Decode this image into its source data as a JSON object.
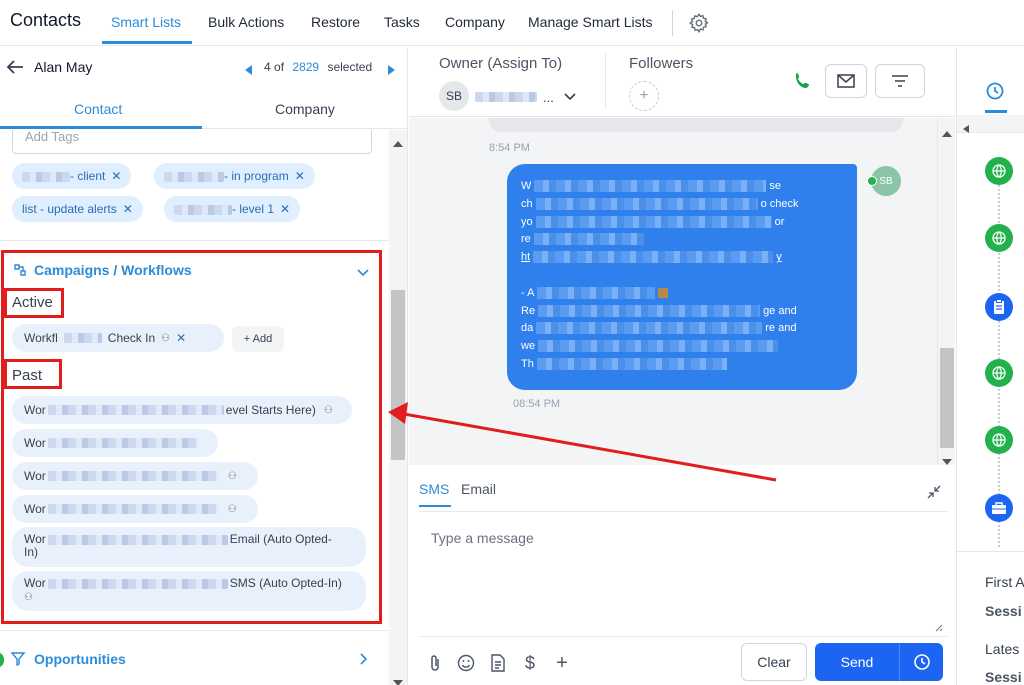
{
  "nav": {
    "app_title": "Contacts",
    "tabs": [
      "Smart Lists",
      "Bulk Actions",
      "Restore",
      "Tasks",
      "Company",
      "Manage Smart Lists"
    ],
    "active_tab": "Smart Lists"
  },
  "contact": {
    "name": "Alan May",
    "position": "4",
    "of": "of",
    "total": "2829",
    "selected_label": "selected"
  },
  "contact_tabs": [
    "Contact",
    "Company"
  ],
  "tags": {
    "placeholder": "Add Tags",
    "chips": [
      "- client",
      "- in program",
      "list - update alerts",
      "- level 1"
    ]
  },
  "campaigns": {
    "title": "Campaigns / Workflows",
    "active_label": "Active",
    "active_items": [
      {
        "prefix": "Workfl",
        "suffix": "Check In"
      }
    ],
    "add_label": "+ Add",
    "past_label": "Past",
    "past_items": [
      {
        "prefix": "Wor",
        "suffix": "evel Starts Here)"
      },
      {
        "prefix": "Wor",
        "suffix": ""
      },
      {
        "prefix": "Wor",
        "suffix": ""
      },
      {
        "prefix": "Wor",
        "suffix": ""
      },
      {
        "prefix": "Wor",
        "suffix": "Email (Auto Opted-",
        "line2": "In)"
      },
      {
        "prefix": "Wor",
        "suffix": "SMS (Auto Opted-In)"
      }
    ]
  },
  "opportunities": {
    "title": "Opportunities"
  },
  "conversation": {
    "owner_label": "Owner (Assign To)",
    "owner_initials": "SB",
    "owner_name_tail": "...",
    "followers_label": "Followers",
    "time_prev": "8:54 PM",
    "message_initials": "SB",
    "message_lines": [
      {
        "start": "W",
        "end": "se"
      },
      {
        "start": "ch",
        "end": "o check"
      },
      {
        "start": "yo",
        "end": "or"
      },
      {
        "start": "re",
        "end": ""
      },
      {
        "start": "ht",
        "end": "y"
      },
      {
        "start": "",
        "end": ""
      },
      {
        "start": "- A",
        "end": ""
      },
      {
        "start": "Re",
        "end": "ge and"
      },
      {
        "start": "da",
        "end": "re and"
      },
      {
        "start": "we",
        "end": ""
      },
      {
        "start": "Th",
        "end": ""
      }
    ],
    "time_msg": "08:54 PM"
  },
  "composer": {
    "tabs": [
      "SMS",
      "Email"
    ],
    "active_tab": "SMS",
    "placeholder": "Type a message",
    "clear_label": "Clear",
    "send_label": "Send"
  },
  "right": {
    "first_label": "First A",
    "session_label_1": "Sessi",
    "latest_label": "Lates",
    "session_label_2": "Sessi"
  },
  "colors": {
    "accent": "#2d8cd8",
    "bubble": "#2f80ed",
    "send": "#1c64f2",
    "annotation_red": "#e11d1d",
    "timeline_green": "#22b14c",
    "timeline_blue": "#1c64f2",
    "phone_green": "#16a34a"
  }
}
